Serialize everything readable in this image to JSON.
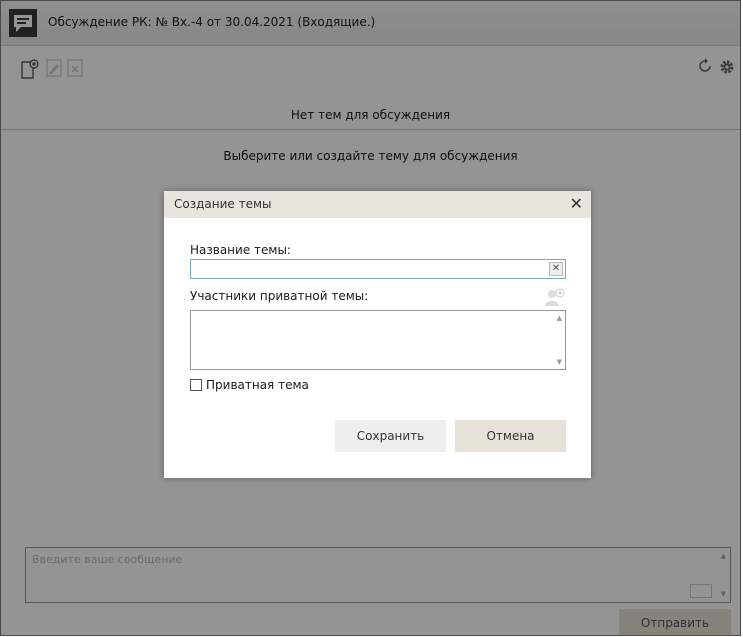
{
  "window": {
    "title": "Обсуждение РК: № Вх.-4 от 30.04.2021 (Входящие.)"
  },
  "toolbar": {
    "left_icons": [
      "new-topic-icon",
      "edit-topic-icon",
      "delete-topic-icon"
    ],
    "right_icons": [
      "refresh-icon",
      "gear-icon"
    ]
  },
  "main": {
    "topics_header": "Нет тем для обсуждения",
    "empty_hint": "Выберите или создайте тему для обсуждения"
  },
  "composer": {
    "placeholder": "Введите ваше сообщение",
    "send_label": "Отправить"
  },
  "dialog": {
    "title": "Создание темы",
    "close_glyph": "✕",
    "name_label": "Название темы:",
    "name_value": "",
    "clear_glyph": "✕",
    "participants_label": "Участники приватной темы:",
    "private_label": "Приватная тема",
    "private_checked": false,
    "save_label": "Сохранить",
    "cancel_label": "Отмена"
  },
  "colors": {
    "overlay": "#000000",
    "dialog_header": "#e8e5de",
    "cancel_button": "#e7e2d8",
    "save_button": "#eeeeee",
    "input_focus_border": "#7aa7c7"
  }
}
